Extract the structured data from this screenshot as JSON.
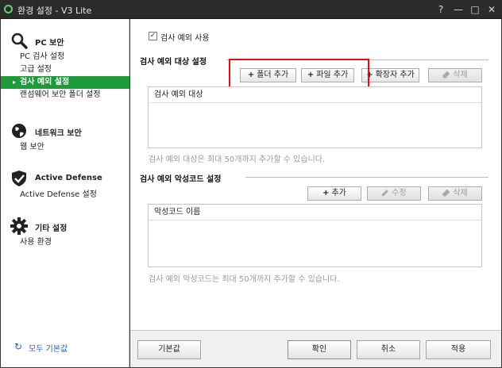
{
  "window": {
    "title": "환경 설정 - V3 Lite",
    "help": "?",
    "minimize": "—",
    "maximize": "□",
    "close": "✕"
  },
  "sidebar": {
    "sections": [
      {
        "icon": "magnifier-icon",
        "label": "PC 보안",
        "items": [
          {
            "label": "PC 검사 설정",
            "active": false
          },
          {
            "label": "고급 설정",
            "active": false
          },
          {
            "label": "검사 예외 설정",
            "active": true
          },
          {
            "label": "랜섬웨어 보안 폴더 설정",
            "active": false
          }
        ]
      },
      {
        "icon": "globe-icon",
        "label": "네트워크 보안",
        "items": [
          {
            "label": "웹 보안",
            "active": false
          }
        ]
      },
      {
        "icon": "shield-check-icon",
        "label": "Active Defense",
        "items": [
          {
            "label": "Active Defense 설정",
            "active": false
          }
        ]
      },
      {
        "icon": "gear-icon",
        "label": "기타 설정",
        "items": [
          {
            "label": "사용 환경",
            "active": false
          }
        ]
      }
    ],
    "reset_all": "모두 기본값"
  },
  "main": {
    "enable_checkbox": {
      "label": "검사 예외 사용",
      "checked": true
    },
    "target_section": {
      "title": "검사 예외 대상 설정",
      "buttons": {
        "add_folder": "폴더 추가",
        "add_file": "파일 추가",
        "add_extension": "확장자 추가",
        "delete": "삭제"
      },
      "list_header": "검사 예외 대상",
      "hint": "검사 예외 대상은 최대 50개까지 추가할 수 있습니다."
    },
    "malware_section": {
      "title": "검사 예외 악성코드 설정",
      "buttons": {
        "add": "추가",
        "edit": "수정",
        "delete": "삭제"
      },
      "list_header": "악성코드 이름",
      "hint": "검사 예외 악성코드는 최대 50개까지 추가할 수 있습니다."
    }
  },
  "footer": {
    "default": "기본값",
    "ok": "확인",
    "cancel": "취소",
    "apply": "적용"
  }
}
